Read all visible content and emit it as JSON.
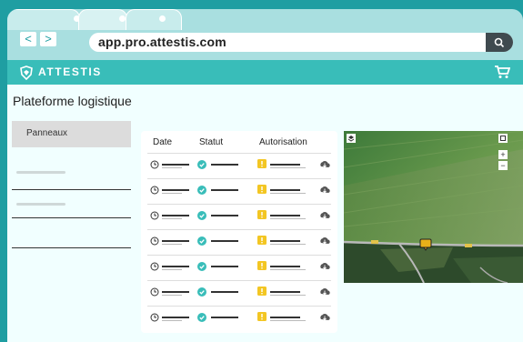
{
  "browser": {
    "url": "app.pro.attestis.com",
    "back_glyph": "<",
    "forward_glyph": ">"
  },
  "header": {
    "brand": "ATTESTIS",
    "logo_icon": "shield-logo-icon",
    "cart_icon": "cart-icon"
  },
  "page": {
    "title": "Plateforme logistique"
  },
  "sidebar": {
    "items": [
      {
        "label": "Panneaux",
        "active": true
      }
    ]
  },
  "table": {
    "columns": [
      "Date",
      "Statut",
      "Autorisation"
    ],
    "row_count": 7,
    "colors": {
      "status_ok": "#39bdb9",
      "warning": "#f3c623",
      "download": "#555555"
    }
  },
  "map": {
    "zoom_in": "+",
    "zoom_out": "−",
    "layers_icon": "layers-icon",
    "fullscreen_icon": "fullscreen-icon",
    "marker_icon": "map-marker-icon"
  },
  "colors": {
    "teal_dark": "#1f9ea2",
    "teal": "#39bdb9",
    "page_bg": "#f1ffff"
  }
}
